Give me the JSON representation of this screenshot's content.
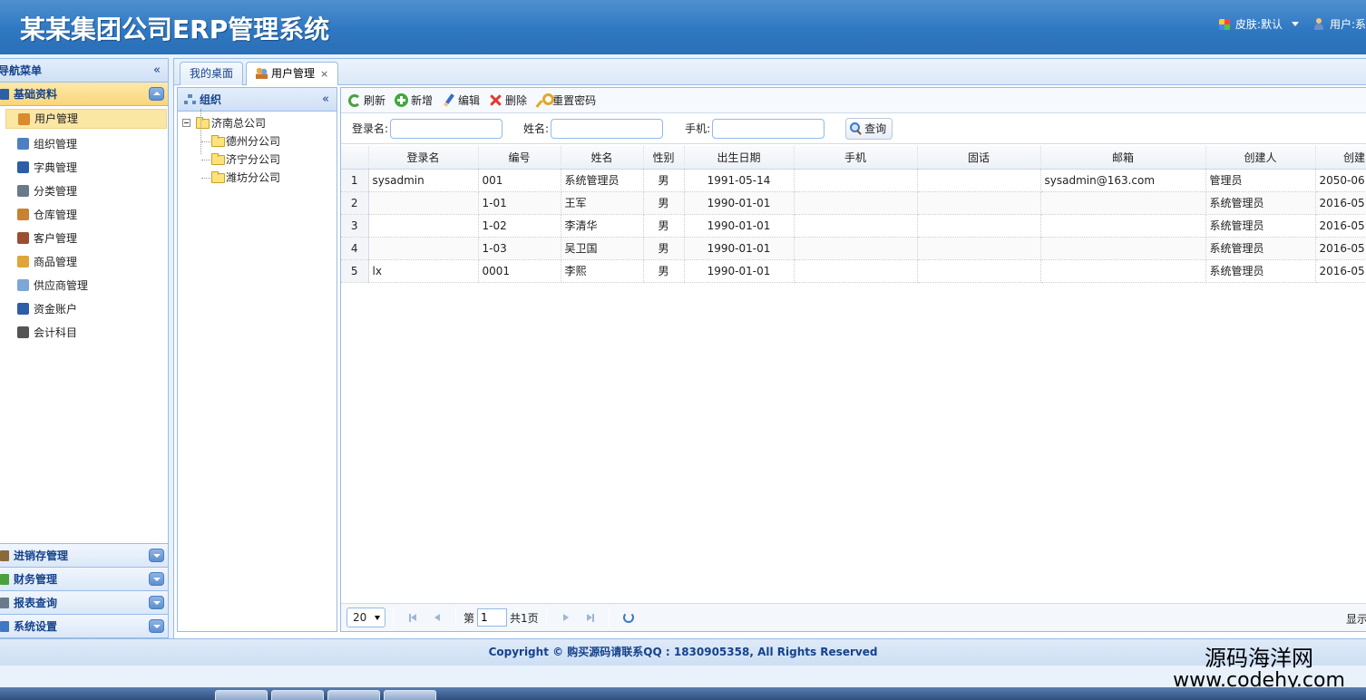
{
  "header": {
    "app_title": "某某集团公司ERP管理系统",
    "skin_label": "皮肤:默认",
    "user_label": "用户:系"
  },
  "nav": {
    "title": "导航菜单",
    "active_group": "基础资料",
    "items": [
      {
        "label": "用户管理",
        "icon": "users-icon",
        "color": "#d88b2f"
      },
      {
        "label": "组织管理",
        "icon": "org-icon",
        "color": "#4f7fc0"
      },
      {
        "label": "字典管理",
        "icon": "book-icon",
        "color": "#2d5ea8"
      },
      {
        "label": "分类管理",
        "icon": "category-icon",
        "color": "#6a7a8a"
      },
      {
        "label": "仓库管理",
        "icon": "warehouse-icon",
        "color": "#c9822f"
      },
      {
        "label": "客户管理",
        "icon": "customer-icon",
        "color": "#9b4f2f"
      },
      {
        "label": "商品管理",
        "icon": "product-icon",
        "color": "#e0a53a"
      },
      {
        "label": "供应商管理",
        "icon": "supplier-icon",
        "color": "#7fa6d8"
      },
      {
        "label": "资金账户",
        "icon": "account-icon",
        "color": "#2d5ea8"
      },
      {
        "label": "会计科目",
        "icon": "list-icon",
        "color": "#555555"
      }
    ],
    "other_groups": [
      "进销存管理",
      "财务管理",
      "报表查询",
      "系统设置"
    ]
  },
  "tabs": [
    {
      "label": "我的桌面"
    },
    {
      "label": "用户管理",
      "close": "×"
    }
  ],
  "org": {
    "title": "组织",
    "root": "济南总公司",
    "children": [
      "德州分公司",
      "济宁分公司",
      "潍坊分公司"
    ]
  },
  "toolbar": {
    "refresh": "刷新",
    "add": "新增",
    "edit": "编辑",
    "delete": "删除",
    "reset_password": "重置密码"
  },
  "search": {
    "login_label": "登录名:",
    "name_label": "姓名:",
    "phone_label": "手机:",
    "login_value": "",
    "name_value": "",
    "phone_value": "",
    "button": "查询"
  },
  "grid": {
    "columns": [
      "登录名",
      "编号",
      "姓名",
      "性别",
      "出生日期",
      "手机",
      "固话",
      "邮箱",
      "创建人",
      "创建"
    ],
    "rows": [
      {
        "n": "1",
        "login": "sysadmin",
        "code": "001",
        "name": "系统管理员",
        "sex": "男",
        "birth": "1991-05-14",
        "mobile": "",
        "tel": "",
        "email": "sysadmin@163.com",
        "creator": "管理员",
        "created": "2050-06"
      },
      {
        "n": "2",
        "login": "",
        "code": "1-01",
        "name": "王军",
        "sex": "男",
        "birth": "1990-01-01",
        "mobile": "",
        "tel": "",
        "email": "",
        "creator": "系统管理员",
        "created": "2016-05"
      },
      {
        "n": "3",
        "login": "",
        "code": "1-02",
        "name": "李清华",
        "sex": "男",
        "birth": "1990-01-01",
        "mobile": "",
        "tel": "",
        "email": "",
        "creator": "系统管理员",
        "created": "2016-05"
      },
      {
        "n": "4",
        "login": "",
        "code": "1-03",
        "name": "吴卫国",
        "sex": "男",
        "birth": "1990-01-01",
        "mobile": "",
        "tel": "",
        "email": "",
        "creator": "系统管理员",
        "created": "2016-05"
      },
      {
        "n": "5",
        "login": "lx",
        "code": "0001",
        "name": "李熙",
        "sex": "男",
        "birth": "1990-01-01",
        "mobile": "",
        "tel": "",
        "email": "",
        "creator": "系统管理员",
        "created": "2016-05"
      }
    ]
  },
  "pager": {
    "page_size": "20",
    "page_prefix": "第",
    "page_value": "1",
    "page_suffix": "共1页",
    "info": "显示"
  },
  "footer": {
    "copyright": "Copyright © 购买源码请联系QQ : 1830905358, All Rights Reserved"
  },
  "watermark": {
    "line1": "源码海洋网",
    "line2": "www.codehy.com"
  }
}
